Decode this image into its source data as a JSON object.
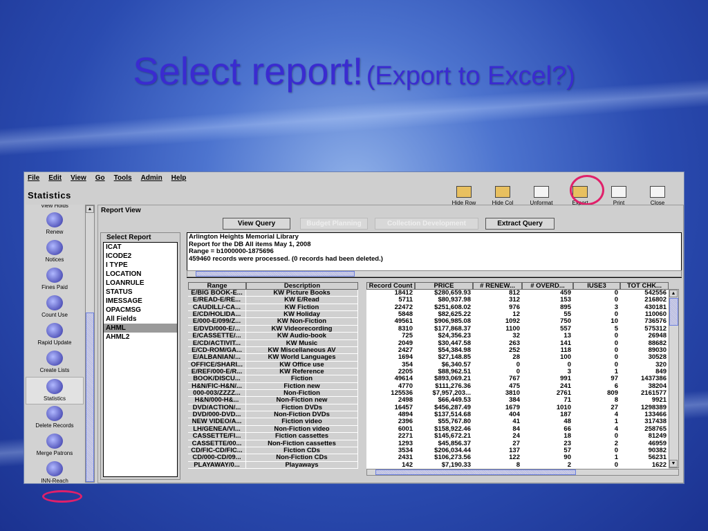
{
  "slide": {
    "title": "Select report!",
    "subtitle": "(Export to Excel?)"
  },
  "menu": [
    "File",
    "Edit",
    "View",
    "Go",
    "Tools",
    "Admin",
    "Help"
  ],
  "app_title": "Statistics",
  "toolbar": [
    {
      "label": "Hide Row",
      "icon": "hide-row-icon"
    },
    {
      "label": "Hide Col",
      "icon": "hide-col-icon"
    },
    {
      "label": "Unformat",
      "icon": "unformat-icon"
    },
    {
      "label": "Export",
      "icon": "export-icon"
    },
    {
      "label": "Print",
      "icon": "print-icon"
    },
    {
      "label": "Close",
      "icon": "close-folder-icon"
    }
  ],
  "sidebar": {
    "partial_top": "View Holds",
    "items": [
      "Renew",
      "Notices",
      "Fines Paid",
      "Count Use",
      "Rapid Update",
      "Create Lists",
      "Statistics",
      "Delete Records",
      "Merge Patrons",
      "INN-Reach"
    ],
    "active": "Statistics"
  },
  "report_view": {
    "label": "Report View",
    "buttons": [
      {
        "label": "View Query",
        "enabled": true
      },
      {
        "label": "Budget Planning",
        "enabled": false
      },
      {
        "label": "Collection Development",
        "enabled": false
      },
      {
        "label": "Extract Query",
        "enabled": true
      }
    ],
    "select_report": {
      "label": "Select Report",
      "items": [
        "ICAT",
        "ICODE2",
        "I TYPE",
        "LOCATION",
        "LOANRULE",
        "STATUS",
        "IMESSAGE",
        "OPACMSG",
        "All Fields",
        "AHML",
        "AHML2"
      ],
      "selected": "AHML"
    },
    "info": [
      "Arlington Heights Memorial Library",
      "Report for the DB All items May 1, 2008",
      "Range = b1000000-1875696",
      "459460 records were processed.  (0 records had been deleted.)"
    ]
  },
  "table": {
    "left_columns": [
      "Range",
      "Description"
    ],
    "right_columns": [
      "Record Count",
      "PRICE",
      "# RENEW...",
      "# OVERD...",
      "IUSE3",
      "TOT CHK..."
    ],
    "rows": [
      [
        "E/BIG BOOK-E...",
        "KW Picture Books",
        "18412",
        "$280,659.93",
        "812",
        "459",
        "0",
        "542556"
      ],
      [
        "E/READ-E/RE...",
        "KW E/Read",
        "5711",
        "$80,937.98",
        "312",
        "153",
        "0",
        "216802"
      ],
      [
        "CAUDILL/-CA...",
        "KW Fiction",
        "22472",
        "$251,608.02",
        "976",
        "895",
        "3",
        "430181"
      ],
      [
        "E/CD/HOLIDA...",
        "KW Holiday",
        "5848",
        "$82,625.22",
        "12",
        "55",
        "0",
        "110060"
      ],
      [
        "E/000-E/099/Z...",
        "KW Non-Fiction",
        "49561",
        "$906,985.08",
        "1092",
        "750",
        "10",
        "736576"
      ],
      [
        "E/DVD/000-E/...",
        "KW Videorecording",
        "8310",
        "$177,868.37",
        "1100",
        "557",
        "5",
        "575312"
      ],
      [
        "E/CASSETTE/...",
        "KW Audio-book",
        "725",
        "$24,356.23",
        "32",
        "13",
        "0",
        "26948"
      ],
      [
        "E/CD/ACTIVIT...",
        "KW Music",
        "2049",
        "$30,447.58",
        "263",
        "141",
        "0",
        "88682"
      ],
      [
        "E/CD-ROM/GA...",
        "KW Miscellaneous AV",
        "2427",
        "$54,384.98",
        "252",
        "118",
        "0",
        "89030"
      ],
      [
        "E/ALBANIAN/...",
        "KW World Languages",
        "1694",
        "$27,148.85",
        "28",
        "100",
        "0",
        "30528"
      ],
      [
        "OFFICE/SHARI...",
        "KW Office use",
        "354",
        "$6,340.57",
        "0",
        "0",
        "0",
        "320"
      ],
      [
        "E/REF/000-E/R...",
        "KW Reference",
        "2205",
        "$88,962.51",
        "0",
        "3",
        "1",
        "849"
      ],
      [
        "BOOK/DISCU...",
        "Fiction",
        "49614",
        "$893,069.21",
        "767",
        "991",
        "97",
        "1437386"
      ],
      [
        "H&N/FIC-H&N/...",
        "Fiction new",
        "4770",
        "$111,276.36",
        "475",
        "241",
        "6",
        "38204"
      ],
      [
        "000-003/ZZZZ...",
        "Non-Fiction",
        "125536",
        "$7,957,203...",
        "3810",
        "2761",
        "809",
        "2161577"
      ],
      [
        "H&N/000-H&...",
        "Non-Fiction new",
        "2498",
        "$66,449.53",
        "384",
        "71",
        "8",
        "9921"
      ],
      [
        "DVD/ACTION/...",
        "Fiction DVDs",
        "16457",
        "$456,287.49",
        "1679",
        "1010",
        "27",
        "1298389"
      ],
      [
        "DVD/000-DVD...",
        "Non-Fiction DVDs",
        "4894",
        "$137,514.68",
        "404",
        "187",
        "4",
        "133466"
      ],
      [
        "NEW VIDEO/A...",
        "Fiction video",
        "2396",
        "$55,767.80",
        "41",
        "48",
        "1",
        "317438"
      ],
      [
        "LH/GENEA/VI...",
        "Non-Fiction video",
        "6001",
        "$158,922.46",
        "84",
        "66",
        "4",
        "258765"
      ],
      [
        "CASSETTE/FI...",
        "Fiction cassettes",
        "2271",
        "$145,672.21",
        "24",
        "18",
        "0",
        "81249"
      ],
      [
        "CASSETTE/00...",
        "Non-Fiction cassettes",
        "1293",
        "$45,856.37",
        "27",
        "23",
        "2",
        "46959"
      ],
      [
        "CD/FIC-CD/FIC...",
        "Fiction CDs",
        "3534",
        "$206,034.44",
        "137",
        "57",
        "0",
        "90382"
      ],
      [
        "CD/000-CD/09...",
        "Non-Fiction CDs",
        "2431",
        "$106,273.56",
        "122",
        "90",
        "1",
        "56231"
      ],
      [
        "PLAYAWAY/0...",
        "Playaways",
        "142",
        "$7,190.33",
        "8",
        "2",
        "0",
        "1622"
      ]
    ]
  },
  "colors": {
    "title": "#3a2bd0",
    "highlight": "#e0206a"
  }
}
